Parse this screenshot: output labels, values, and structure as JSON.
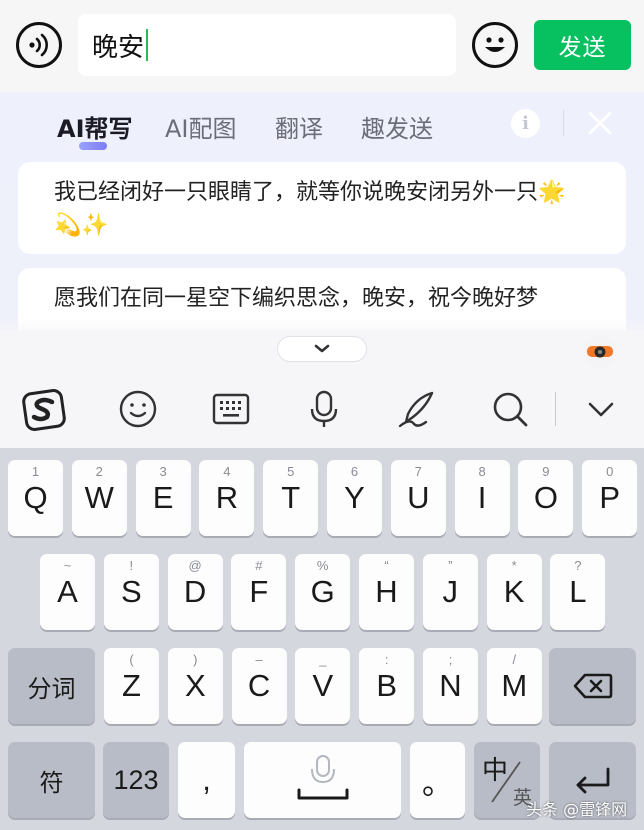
{
  "input_bar": {
    "text": "晚安",
    "send_label": "发送"
  },
  "ai_panel": {
    "tabs": [
      {
        "label": "AI帮写",
        "active": true
      },
      {
        "label": "AI配图",
        "active": false
      },
      {
        "label": "翻译",
        "active": false
      },
      {
        "label": "趣发送",
        "active": false
      }
    ],
    "suggestions": [
      {
        "text": "我已经闭好一只眼睛了，就等你说晚安闭另外一只🌟💫✨"
      },
      {
        "text": "愿我们在同一星空下编织思念，晚安，祝今晚好梦"
      }
    ]
  },
  "toolbar": {
    "icons": [
      "sogou-logo-icon",
      "emoji-icon",
      "keyboard-icon",
      "microphone-icon",
      "handwriting-icon",
      "search-icon",
      "chevron-down-icon"
    ]
  },
  "keyboard": {
    "row1": [
      {
        "main": "Q",
        "sub": "1"
      },
      {
        "main": "W",
        "sub": "2"
      },
      {
        "main": "E",
        "sub": "3"
      },
      {
        "main": "R",
        "sub": "4"
      },
      {
        "main": "T",
        "sub": "5"
      },
      {
        "main": "Y",
        "sub": "6"
      },
      {
        "main": "U",
        "sub": "7"
      },
      {
        "main": "I",
        "sub": "8"
      },
      {
        "main": "O",
        "sub": "9"
      },
      {
        "main": "P",
        "sub": "0"
      }
    ],
    "row2": [
      {
        "main": "A",
        "sub": "~"
      },
      {
        "main": "S",
        "sub": "!"
      },
      {
        "main": "D",
        "sub": "@"
      },
      {
        "main": "F",
        "sub": "#"
      },
      {
        "main": "G",
        "sub": "%"
      },
      {
        "main": "H",
        "sub": "“"
      },
      {
        "main": "J",
        "sub": "”"
      },
      {
        "main": "K",
        "sub": "*"
      },
      {
        "main": "L",
        "sub": "?"
      }
    ],
    "row3_left": "分词",
    "row3": [
      {
        "main": "Z",
        "sub": "("
      },
      {
        "main": "X",
        "sub": ")"
      },
      {
        "main": "C",
        "sub": "–"
      },
      {
        "main": "V",
        "sub": "_"
      },
      {
        "main": "B",
        "sub": ":"
      },
      {
        "main": "N",
        "sub": ";"
      },
      {
        "main": "M",
        "sub": "/"
      }
    ],
    "row4": {
      "symbol": "符",
      "numbers": "123",
      "comma": ",",
      "period": "。",
      "lang_primary": "中",
      "lang_secondary": "英"
    }
  },
  "watermark": "头条 @雷锋网"
}
